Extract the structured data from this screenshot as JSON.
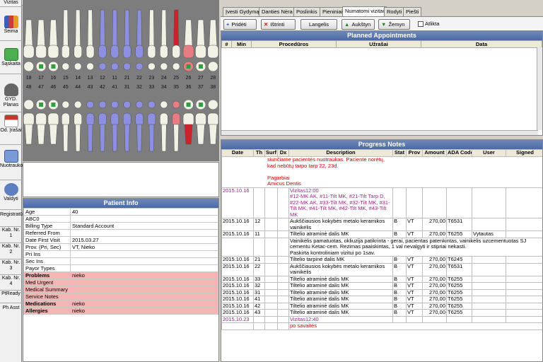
{
  "window_top": {
    "sidebar_first_label": "Vizitas"
  },
  "sidebar": {
    "items": [
      {
        "label": "Šeima",
        "icon": "family-icon"
      },
      {
        "label": "Sąskaita",
        "icon": "invoice-icon"
      },
      {
        "label": "GYD. Planas",
        "icon": "tooth-plan-icon"
      },
      {
        "label": "Od. Įrašai",
        "icon": "records-icon"
      },
      {
        "label": "Nuotraukos",
        "icon": "camera-icon"
      },
      {
        "label": "Valdyti",
        "icon": "gear-icon"
      }
    ],
    "small_items": [
      "Registratūra",
      "Kab. Nr. 1",
      "Kab. Nr. 2",
      "Kab. Nr. 3",
      "Kab. Nr. 4",
      "PtReady",
      "Ph Asst"
    ]
  },
  "tooth_chart": {
    "upper_numbers": [
      "18",
      "17",
      "16",
      "15",
      "14",
      "13",
      "12",
      "11",
      "21",
      "22",
      "23",
      "24",
      "25",
      "26",
      "27",
      "28"
    ],
    "lower_numbers": [
      "48",
      "47",
      "46",
      "45",
      "44",
      "43",
      "42",
      "41",
      "31",
      "32",
      "33",
      "34",
      "35",
      "36",
      "37",
      "38"
    ],
    "colors": {
      "background": "#7d7d7d",
      "tooth": "#f2f1e6",
      "treated": "#8d8fe0",
      "crown_red": "#e77d82",
      "implant_red": "#d0202a",
      "filling_green": "#2ea043"
    }
  },
  "patient_info": {
    "title": "Patient Info",
    "rows": [
      {
        "label": "Age",
        "value": "40",
        "alert": false,
        "bold": false
      },
      {
        "label": "ABC0",
        "value": "",
        "alert": false,
        "bold": false
      },
      {
        "label": "Billing Type",
        "value": "Standard Account",
        "alert": false,
        "bold": false
      },
      {
        "label": "Referred From",
        "value": "",
        "alert": false,
        "bold": false
      },
      {
        "label": "Date First Visit",
        "value": "2015.03.27",
        "alert": false,
        "bold": false
      },
      {
        "label": "Prov. (Pri, Sec)",
        "value": "VT, Nieko",
        "alert": false,
        "bold": false
      },
      {
        "label": "Pri Ins",
        "value": "",
        "alert": false,
        "bold": false
      },
      {
        "label": "Sec Ins",
        "value": "",
        "alert": false,
        "bold": false
      },
      {
        "label": "Payor Types",
        "value": "",
        "alert": false,
        "bold": false
      },
      {
        "label": "Problems",
        "value": "nieko",
        "alert": true,
        "bold": true
      },
      {
        "label": "Med Urgent",
        "value": "",
        "alert": true,
        "bold": false
      },
      {
        "label": "Medical Summary",
        "value": "",
        "alert": true,
        "bold": false
      },
      {
        "label": "Service Notes",
        "value": "",
        "alert": true,
        "bold": false
      },
      {
        "label": "Medications",
        "value": "nieko",
        "alert": true,
        "bold": true
      },
      {
        "label": "Allergies",
        "value": "nieko",
        "alert": true,
        "bold": true
      }
    ]
  },
  "tabs": [
    {
      "label": "Įvesti Gydymą",
      "active": false
    },
    {
      "label": "Danties Nėra",
      "active": false
    },
    {
      "label": "Poslinkis",
      "active": false
    },
    {
      "label": "Pieniniai",
      "active": false
    },
    {
      "label": "Numatomi vizitai",
      "active": true
    },
    {
      "label": "Rodyti",
      "active": false
    },
    {
      "label": "Piešti",
      "active": false
    }
  ],
  "toolbar": {
    "add": "Pridėti",
    "delete": "Ištrinti",
    "window": "Langelis",
    "up": "Aukštyn",
    "down": "Žemyn",
    "done": "Atlikta"
  },
  "planned": {
    "title": "Planned Appointments",
    "columns": [
      "#",
      "Min",
      "Procedūros",
      "Užrašai",
      "Data"
    ]
  },
  "progress": {
    "title": "Progress Notes",
    "columns": [
      "Date",
      "Th",
      "Surf",
      "Dx",
      "Description",
      "Stat",
      "Prov",
      "Amount",
      "ADA Code",
      "User",
      "Signed"
    ],
    "rows": [
      {
        "type": "full",
        "lines": [
          "siunčiame pacientės                        nuotraukas. Paciente norėtų,",
          "kad nebūtų tarpo tarp 22, 23d.",
          "",
          "Pagarbiai",
          "Amicus Dentis"
        ],
        "color": "red"
      },
      {
        "type": "visit",
        "date": "2015.10.16",
        "desc": "Vizitas12:00\n#12-MK AK, #11-Tilt MK, #21-Tilt Tarp D, #22-MK AK, #33-Tilt MK, #32-Tilt MK, #31-Tilt MK, #41-Tilt MK, #42-Tilt MK, #43-Tilt MK"
      },
      {
        "type": "proc",
        "date": "2015.10.16",
        "th": "12",
        "desc": "Aukščiausios kokybės metalo keramikos vainikėlis",
        "stat": "B",
        "prov": "VT",
        "amount": "270,00",
        "ada": "T6531",
        "user": ""
      },
      {
        "type": "proc",
        "date": "2015.10.16",
        "th": "11",
        "desc": "Tiltelio atraminė dalis MK",
        "stat": "B",
        "prov": "VT",
        "amount": "270,00",
        "ada": "T6255",
        "user": "Vytautas"
      },
      {
        "type": "note",
        "text": "Vainikėlis pamatuotas, okliuzija patikrinta - gerai, pacientas patenkintas, vainikėlis uzcementuotas SJ cementu Ketac-cem. Rezimas paaiskintas, 1 val nevalgyti ir stipriai nekasti.\nPaskirta kontroliniam vizitui po 1sav."
      },
      {
        "type": "proc",
        "date": "2015.10.16",
        "th": "21",
        "desc": "Tiltelio tarpinė dalis MK",
        "stat": "B",
        "prov": "VT",
        "amount": "270,00",
        "ada": "T6245",
        "user": ""
      },
      {
        "type": "proc",
        "date": "2015.10.16",
        "th": "22",
        "desc": "Aukščiausios kokybės metalo keramikos vainikėlis",
        "stat": "B",
        "prov": "VT",
        "amount": "270,00",
        "ada": "T6531",
        "user": ""
      },
      {
        "type": "proc",
        "date": "2015.10.16",
        "th": "33",
        "desc": "Tiltelio atraminė dalis MK",
        "stat": "B",
        "prov": "VT",
        "amount": "270,00",
        "ada": "T6255",
        "user": ""
      },
      {
        "type": "proc",
        "date": "2015.10.16",
        "th": "32",
        "desc": "Tiltelio atraminė dalis MK",
        "stat": "B",
        "prov": "VT",
        "amount": "270,00",
        "ada": "T6255",
        "user": ""
      },
      {
        "type": "proc",
        "date": "2015.10.16",
        "th": "31",
        "desc": "Tiltelio atraminė dalis MK",
        "stat": "B",
        "prov": "VT",
        "amount": "270,00",
        "ada": "T6255",
        "user": ""
      },
      {
        "type": "proc",
        "date": "2015.10.16",
        "th": "41",
        "desc": "Tiltelio atraminė dalis MK",
        "stat": "B",
        "prov": "VT",
        "amount": "270,00",
        "ada": "T6255",
        "user": ""
      },
      {
        "type": "proc",
        "date": "2015.10.16",
        "th": "42",
        "desc": "Tiltelio atraminė dalis MK",
        "stat": "B",
        "prov": "VT",
        "amount": "270,00",
        "ada": "T6255",
        "user": ""
      },
      {
        "type": "proc",
        "date": "2015.10.16",
        "th": "43",
        "desc": "Tiltelio atraminė dalis MK",
        "stat": "B",
        "prov": "VT",
        "amount": "270,00",
        "ada": "T6255",
        "user": ""
      },
      {
        "type": "visit",
        "date": "2015.10.23",
        "desc": "Vizitas12:40"
      },
      {
        "type": "fullred",
        "text": "po savaitės"
      }
    ]
  }
}
